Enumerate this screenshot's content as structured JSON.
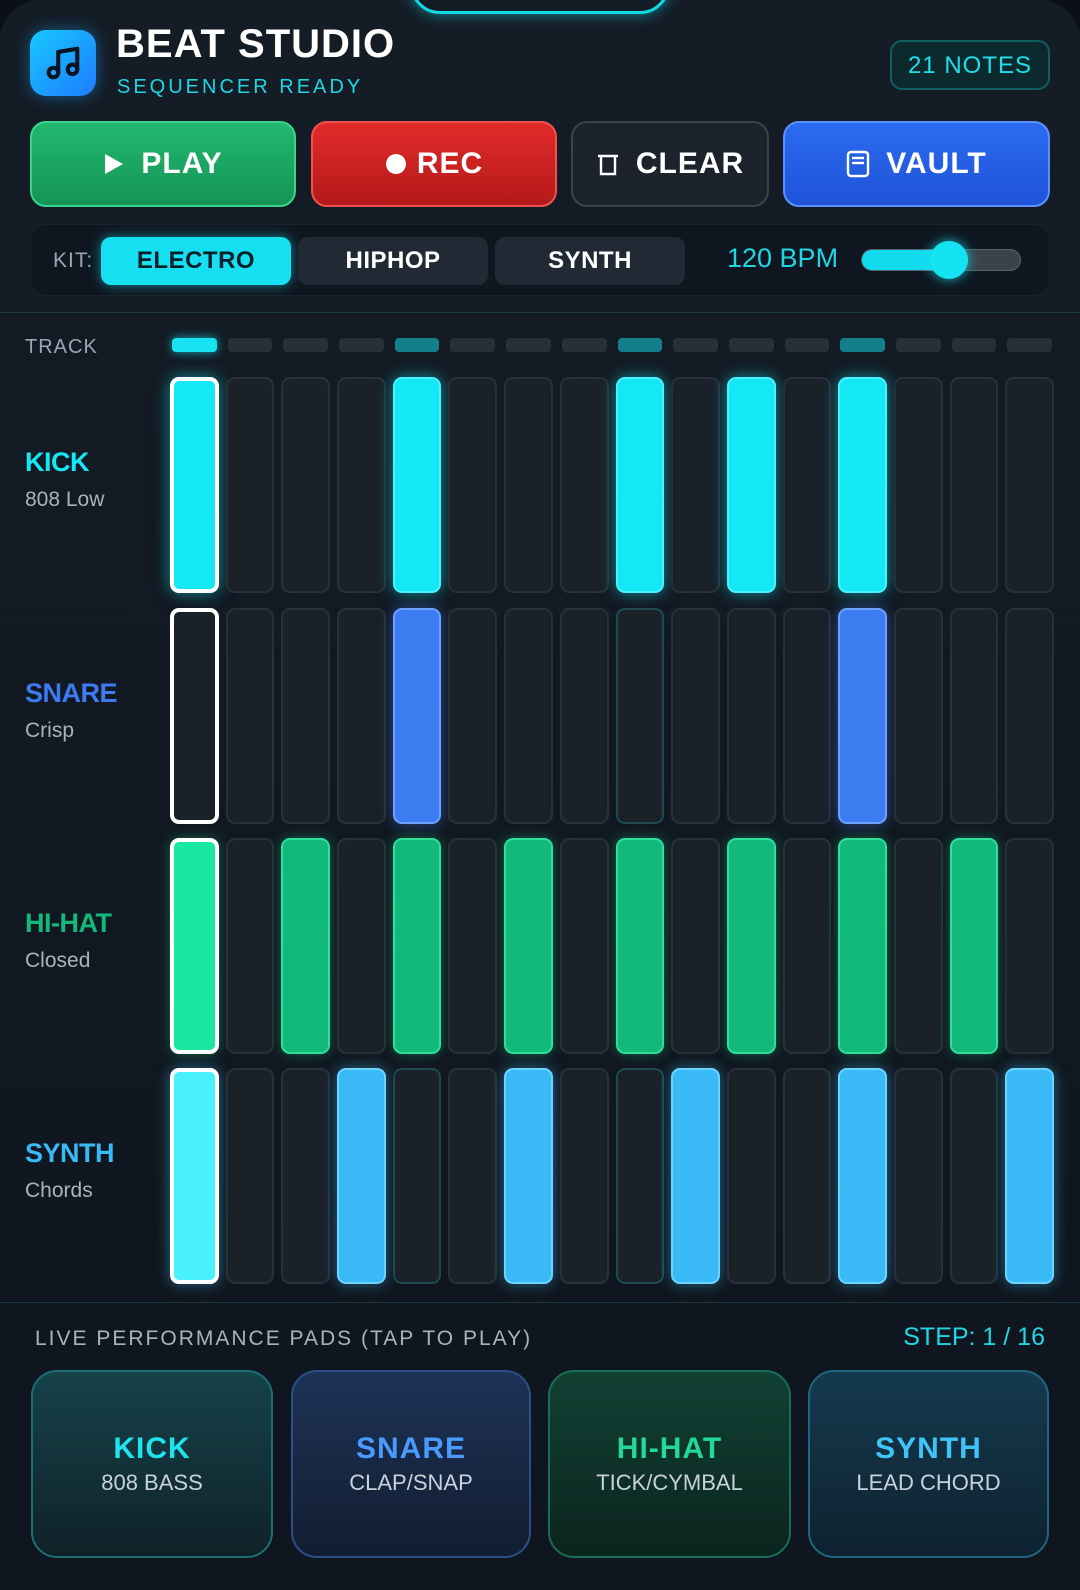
{
  "header": {
    "title": "BEAT STUDIO",
    "status": "SEQUENCER READY",
    "notes_badge": "21 NOTES",
    "app_icon": "music-note-icon"
  },
  "transport": {
    "play": {
      "label": "PLAY",
      "icon": "play-icon"
    },
    "rec": {
      "label": "REC",
      "icon": "record-dot-icon"
    },
    "clear": {
      "label": "CLEAR",
      "icon": "trash-icon"
    },
    "vault": {
      "label": "VAULT",
      "icon": "vault-icon"
    }
  },
  "kit": {
    "label": "KIT:",
    "options": [
      "ELECTRO",
      "HIPHOP",
      "SYNTH"
    ],
    "selected": "ELECTRO",
    "bpm_label": "120 BPM",
    "tempo_slider_fraction": 0.55
  },
  "sequencer": {
    "header_label": "TRACK",
    "steps": 16,
    "current_step": 1,
    "tracks": [
      {
        "name": "KICK",
        "sub": "808 Low",
        "color": "#14e8f5",
        "pattern": [
          1,
          0,
          0,
          0,
          1,
          0,
          0,
          0,
          1,
          0,
          1,
          0,
          1,
          0,
          0,
          0
        ]
      },
      {
        "name": "SNARE",
        "sub": "Crisp",
        "color": "#3c7cf0",
        "pattern": [
          0,
          0,
          0,
          0,
          1,
          0,
          0,
          0,
          0,
          0,
          0,
          0,
          1,
          0,
          0,
          0
        ]
      },
      {
        "name": "HI-HAT",
        "sub": "Closed",
        "color": "#13b97a",
        "pattern": [
          1,
          0,
          1,
          0,
          1,
          0,
          1,
          0,
          1,
          0,
          1,
          0,
          1,
          0,
          1,
          0
        ]
      },
      {
        "name": "SYNTH",
        "sub": "Chords",
        "color": "#39baf6",
        "pattern": [
          1,
          0,
          0,
          1,
          0,
          0,
          1,
          0,
          0,
          1,
          0,
          0,
          1,
          0,
          0,
          1
        ]
      }
    ]
  },
  "performance": {
    "title": "LIVE PERFORMANCE PADS (TAP TO PLAY)",
    "step_counter": "STEP: 1 / 16",
    "pads": [
      {
        "name": "KICK",
        "sub": "808 BASS"
      },
      {
        "name": "SNARE",
        "sub": "CLAP/SNAP"
      },
      {
        "name": "HI-HAT",
        "sub": "TICK/CYMBAL"
      },
      {
        "name": "SYNTH",
        "sub": "LEAD CHORD"
      }
    ]
  }
}
